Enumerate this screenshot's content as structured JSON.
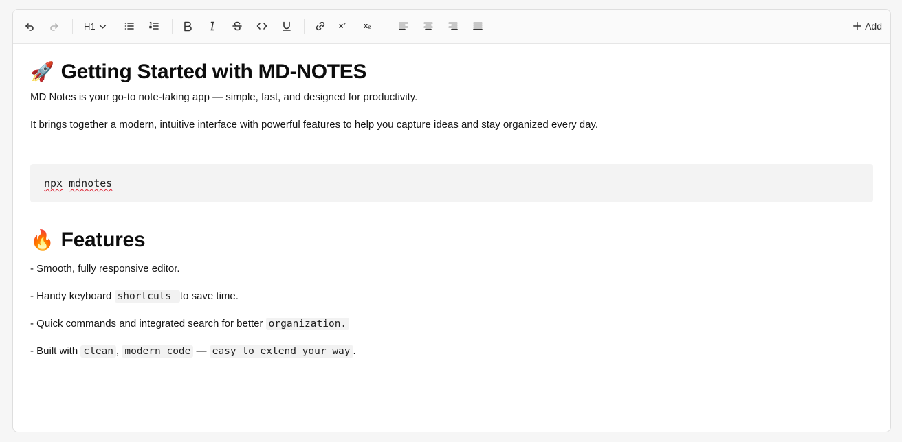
{
  "toolbar": {
    "heading_select": "H1",
    "superscript_label": "x²",
    "subscript_label": "x₂",
    "add_label": "Add"
  },
  "doc": {
    "title_emoji": "🚀",
    "title": "Getting Started with MD-NOTES",
    "intro_p1": "MD Notes is your go-to note-taking app — simple, fast, and designed for productivity.",
    "intro_p2": "It brings together a modern, intuitive interface with powerful features to help you capture ideas and stay organized every day.",
    "code_cmd": "npx",
    "code_arg": "mdnotes",
    "features_emoji": "🔥",
    "features_title": "Features",
    "feature1": "- Smooth, fully responsive editor.",
    "feature2_pre": "- Handy keyboard ",
    "feature2_code": "shortcuts ",
    "feature2_post": " to save time.",
    "feature3_pre": "- Quick commands and integrated search for better ",
    "feature3_code": "organization.",
    "feature4_pre": "- Built with ",
    "feature4_code1": " clean",
    "feature4_comma": ", ",
    "feature4_code2": "modern code",
    "feature4_dash": " — ",
    "feature4_code3": "easy to extend your way",
    "feature4_end": "."
  }
}
